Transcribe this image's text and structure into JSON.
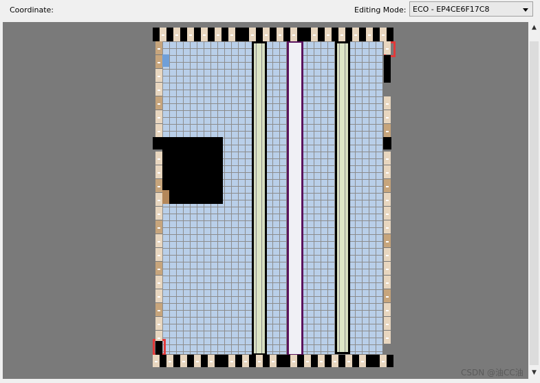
{
  "toolbar": {
    "coordinate_label": "Coordinate:",
    "editing_mode_label": "Editing Mode:",
    "editing_mode_value": "ECO - EP4CE6F17C8"
  },
  "canvas": {
    "background_color": "#7a7a7a",
    "logic_cell_color": "#b9cfe9",
    "memory_column_color": "#d7dfc1",
    "dsp_column_border_color": "#5a135e",
    "selection_border_color": "#e23a3a",
    "io_light_color": "#e8d6bf",
    "io_dark_color": "#c7a57c"
  },
  "scrollbar": {
    "up_icon": "chevron-up-icon",
    "down_icon": "chevron-down-icon"
  },
  "watermark": "CSDN @油CC油"
}
